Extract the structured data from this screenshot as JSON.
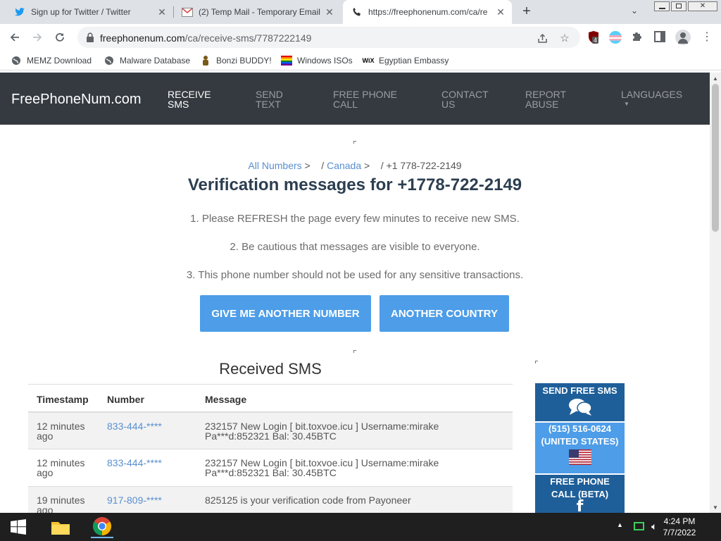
{
  "browser": {
    "tabs": [
      {
        "title": "Sign up for Twitter / Twitter",
        "icon": "twitter-icon"
      },
      {
        "title": "(2) Temp Mail - Temporary Email",
        "icon": "gmail-icon"
      },
      {
        "title": "https://freephonenum.com/ca/re",
        "icon": "phone-icon",
        "active": true
      }
    ],
    "new_tab": "+",
    "url_host": "freephonenum.com",
    "url_path": "/ca/receive-sms/7787222149",
    "extension_badge": "4",
    "bookmarks": [
      {
        "label": "MEMZ Download",
        "icon": "globe-icon"
      },
      {
        "label": "Malware Database",
        "icon": "globe-icon"
      },
      {
        "label": "Bonzi BUDDY!",
        "icon": "bonzi-icon"
      },
      {
        "label": "Windows ISOs",
        "icon": "rainbow-flag-icon"
      },
      {
        "label": "Egyptian Embassy",
        "icon": "wix-icon"
      }
    ]
  },
  "site": {
    "brand": "FreePhoneNum.com",
    "nav": [
      {
        "line1": "RECEIVE",
        "line2": "SMS",
        "active": true
      },
      {
        "line1": "SEND",
        "line2": "TEXT"
      },
      {
        "line1": "FREE PHONE",
        "line2": "CALL"
      },
      {
        "line1": "CONTACT",
        "line2": "US"
      },
      {
        "line1": "REPORT",
        "line2": "ABUSE"
      },
      {
        "line1": "LANGUAGES",
        "line2": ""
      }
    ],
    "breadcrumb": {
      "all": "All Numbers",
      "sep1": ">",
      "slash1": "/",
      "country": "Canada",
      "sep2": ">",
      "slash2": "/",
      "number": "+1 778-722-2149"
    },
    "heading": "Verification messages for +1778-722-2149",
    "notices": [
      "1. Please REFRESH the page every few minutes to receive new SMS.",
      "2. Be cautious that messages are visible to everyone.",
      "3. This phone number should not be used for any sensitive transactions."
    ],
    "buttons": {
      "another_number": "GIVE ME ANOTHER NUMBER",
      "another_country": "ANOTHER COUNTRY"
    },
    "received_title": "Received SMS",
    "table": {
      "headers": [
        "Timestamp",
        "Number",
        "Message"
      ],
      "rows": [
        {
          "time_1": "12 minutes",
          "time_2": "ago",
          "number": "833-444-****",
          "msg_1": "232157 New Login [ bit.toxvoe.icu ] Username:mirake",
          "msg_2": "Pa***d:852321 Bal: 30.45BTC"
        },
        {
          "time_1": "12 minutes",
          "time_2": "ago",
          "number": "833-444-****",
          "msg_1": "232157 New Login [ bit.toxvoe.icu ] Username:mirake",
          "msg_2": "Pa***d:852321 Bal: 30.45BTC"
        },
        {
          "time_1": "19 minutes",
          "time_2": "ago",
          "number": "917-809-****",
          "msg_1": "825125 is your verification code from Payoneer",
          "msg_2": ""
        }
      ]
    },
    "sidebar": {
      "send_sms": "SEND FREE SMS",
      "phone": "(515) 516-0624",
      "country": "(UNITED STATES)",
      "call_1": "FREE PHONE",
      "call_2": "CALL (BETA)"
    }
  },
  "taskbar": {
    "time": "4:24 PM",
    "date": "7/7/2022"
  },
  "colors": {
    "nav_bg": "#343a40",
    "button_blue": "#4d9de8",
    "side_dark": "#1f5f99",
    "side_light": "#4d9de8",
    "link": "#5a8fd0"
  }
}
